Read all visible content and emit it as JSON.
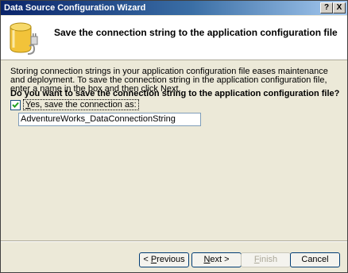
{
  "window": {
    "title": "Data Source Configuration Wizard",
    "help_button": "?",
    "close_button": "X"
  },
  "header": {
    "title": "Save the connection string to the application configuration file",
    "icon": "database-icon"
  },
  "content": {
    "description": "Storing connection strings in your application configuration file eases maintenance and deployment. To save the connection string in the application configuration file, enter a name in the box and then click Next.",
    "question": "Do you want to save the connection string to the application configuration file?",
    "checkbox": {
      "checked": true,
      "label_prefix": "Y",
      "label_rest": "es, save the connection as:"
    },
    "connection_name": "AdventureWorks_DataConnectionString"
  },
  "buttons": {
    "previous_arrow": "< ",
    "previous_key": "P",
    "previous_rest": "revious",
    "next_key": "N",
    "next_rest": "ext >",
    "finish_key": "F",
    "finish_rest": "inish",
    "cancel": "Cancel"
  },
  "colors": {
    "titlebar_start": "#0a246a",
    "titlebar_end": "#a6caf0",
    "dialog_bg": "#ece9d8",
    "button_border": "#003c74",
    "icon_yellow": "#f2c33a"
  }
}
